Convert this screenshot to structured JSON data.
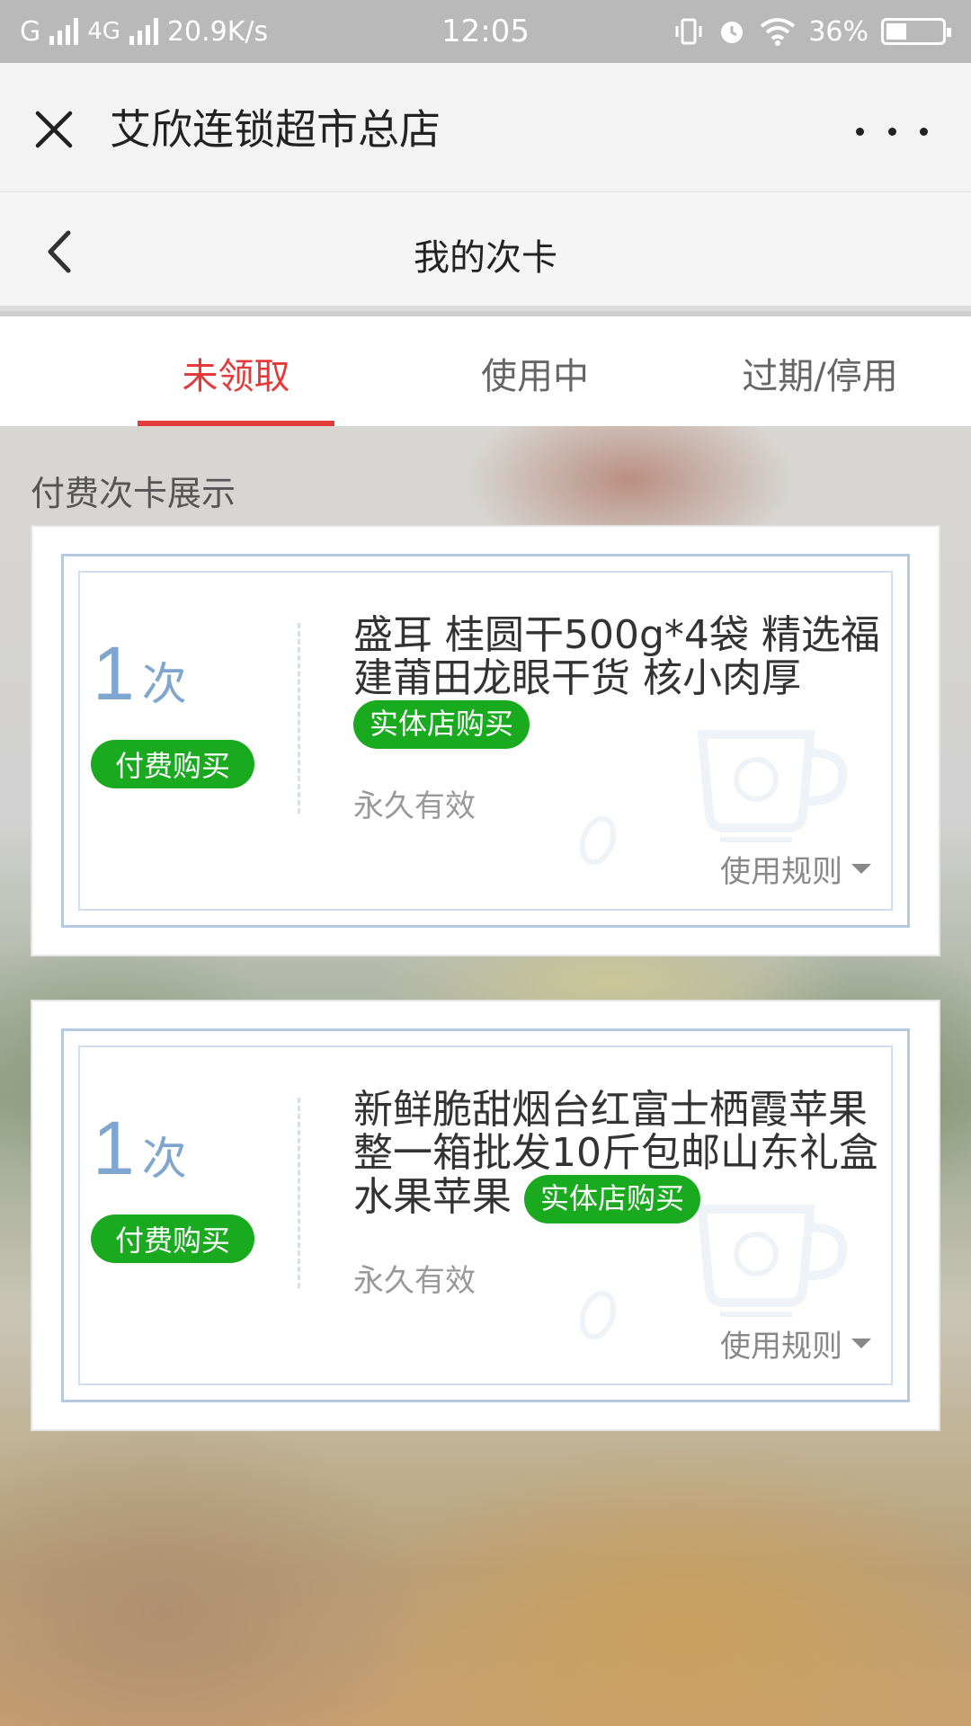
{
  "status_bar": {
    "carrier": "G",
    "network": "4G",
    "speed": "20.9K/s",
    "time": "12:05",
    "battery": "36%",
    "battery_level": 0.36
  },
  "app_bar": {
    "title": "艾欣连锁超市总店",
    "close_icon": "close-icon",
    "more_icon": "more-dots-icon"
  },
  "sub_nav": {
    "title": "我的次卡",
    "back_icon": "chevron-left-icon"
  },
  "tabs": [
    {
      "label": "未领取",
      "active": true
    },
    {
      "label": "使用中",
      "active": false
    },
    {
      "label": "过期/停用",
      "active": false
    }
  ],
  "section_label": "付费次卡展示",
  "cards": [
    {
      "count": "1",
      "unit": "次",
      "paid_label": "付费购买",
      "title": "盛耳 桂圆干500g*4袋 精选福建莆田龙眼干货 核小肉厚",
      "store_label": "实体店购买",
      "validity": "永久有效",
      "rules_label": "使用规则"
    },
    {
      "count": "1",
      "unit": "次",
      "paid_label": "付费购买",
      "title": "新鲜脆甜烟台红富士栖霞苹果整一箱批发10斤包邮山东礼盒水果苹果",
      "store_label": "实体店购买",
      "validity": "永久有效",
      "rules_label": "使用规则"
    }
  ],
  "colors": {
    "accent_red": "#e33b3b",
    "badge_green": "#1aaa20",
    "count_blue": "#7ea6cf"
  }
}
